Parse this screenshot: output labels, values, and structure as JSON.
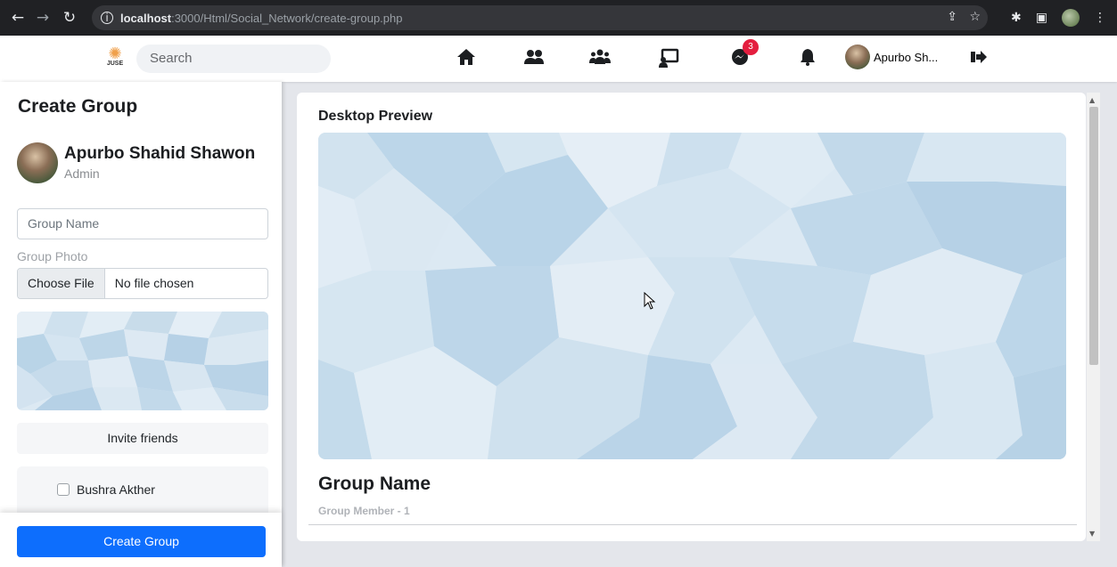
{
  "browser": {
    "url_host": "localhost",
    "url_path": ":3000/Html/Social_Network/create-group.php"
  },
  "header": {
    "logo_text": "JUSE",
    "search_placeholder": "Search",
    "messenger_badge": "3",
    "user_short_name": "Apurbo Sh..."
  },
  "sidebar": {
    "title": "Create Group",
    "admin_name": "Apurbo Shahid Shawon",
    "admin_role": "Admin",
    "group_name_placeholder": "Group Name",
    "group_photo_label": "Group Photo",
    "choose_file_label": "Choose File",
    "no_file_text": "No file chosen",
    "invite_label": "Invite friends",
    "friends": [
      {
        "name": "Bushra Akther",
        "checked": false
      }
    ],
    "create_button_label": "Create Group"
  },
  "main": {
    "preview_label": "Desktop Preview",
    "group_name": "Group Name",
    "group_members": "Group Member - 1"
  },
  "colors": {
    "primary": "#0d6efd",
    "badge": "#e41e3f",
    "cover_light": "#dce9f3",
    "cover_dark": "#b7d3e6"
  }
}
